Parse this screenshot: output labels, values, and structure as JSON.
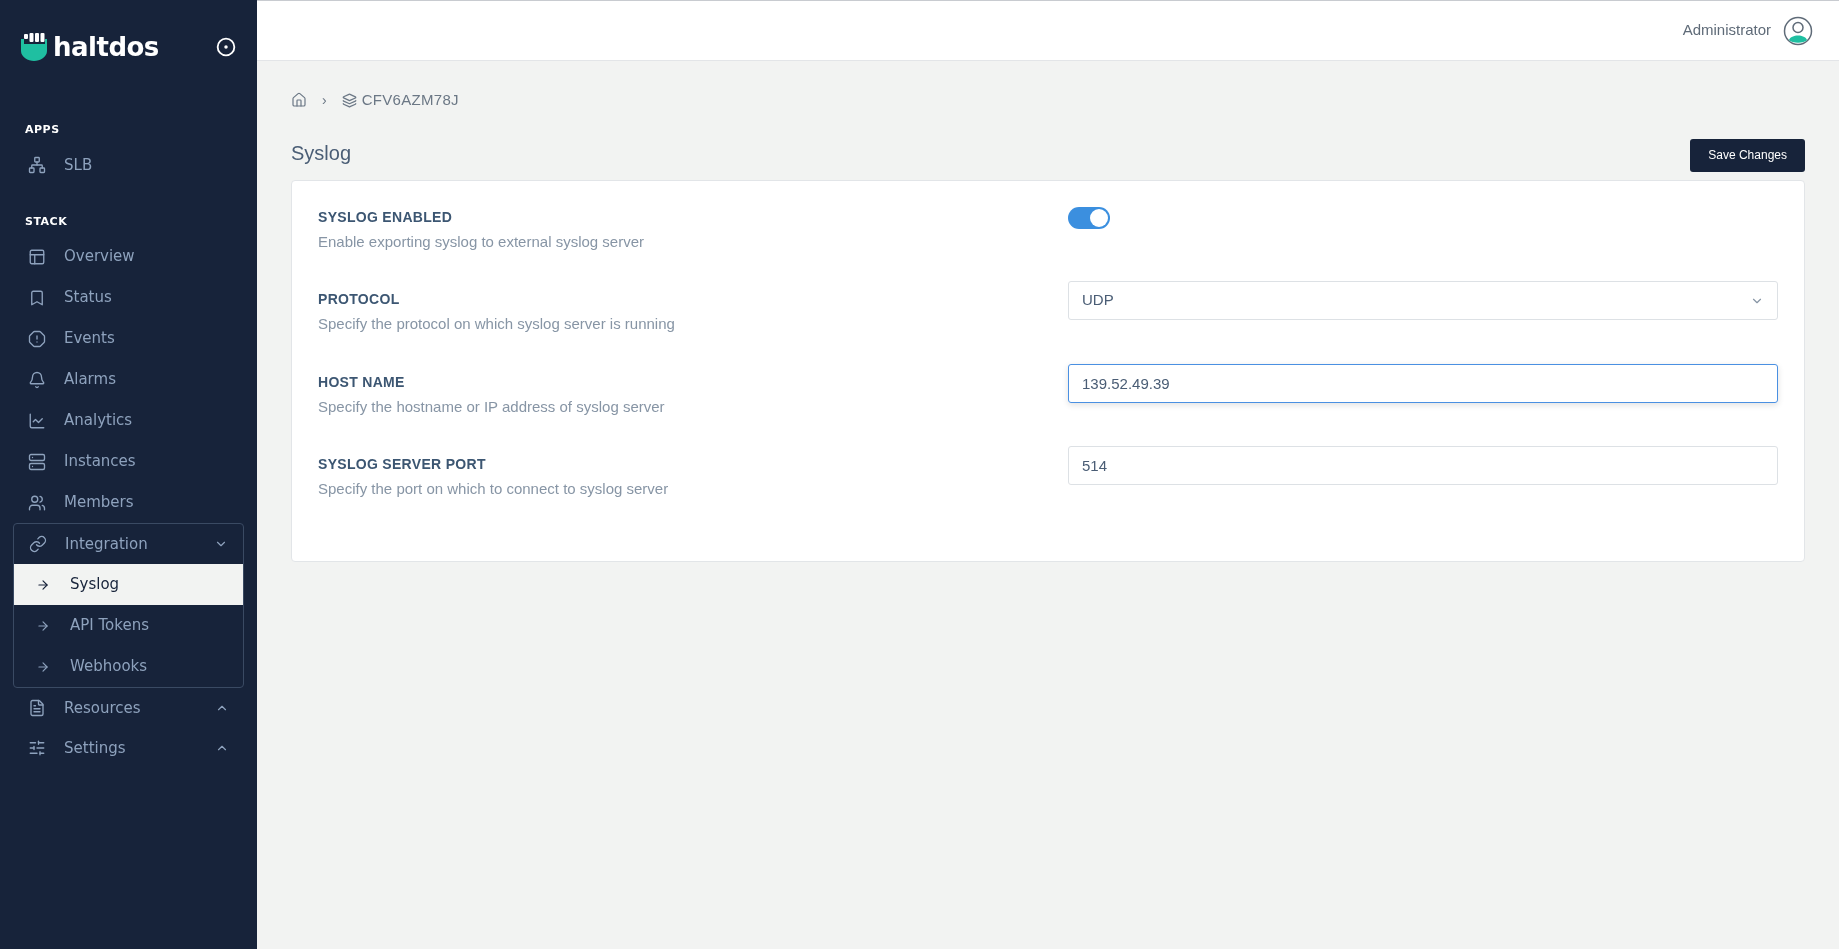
{
  "brand": {
    "name": "haltdos"
  },
  "sidebar": {
    "sections": [
      {
        "title": "APPS",
        "items": [
          {
            "kind": "item",
            "label": "SLB"
          }
        ]
      },
      {
        "title": "STACK",
        "items": [
          {
            "kind": "item",
            "label": "Overview"
          },
          {
            "kind": "item",
            "label": "Status"
          },
          {
            "kind": "item",
            "label": "Events"
          },
          {
            "kind": "item",
            "label": "Alarms"
          },
          {
            "kind": "item",
            "label": "Analytics"
          },
          {
            "kind": "item",
            "label": "Instances"
          },
          {
            "kind": "item",
            "label": "Members"
          },
          {
            "kind": "group",
            "label": "Integration",
            "expanded": true,
            "children": [
              {
                "label": "Syslog",
                "selected": true
              },
              {
                "label": "API Tokens",
                "selected": false
              },
              {
                "label": "Webhooks",
                "selected": false
              }
            ]
          },
          {
            "kind": "group",
            "label": "Resources",
            "expanded": false
          },
          {
            "kind": "group",
            "label": "Settings",
            "expanded": false
          }
        ]
      }
    ]
  },
  "header": {
    "user": "Administrator"
  },
  "breadcrumb": {
    "current": "CFV6AZM78J",
    "separator": "›"
  },
  "page": {
    "title": "Syslog",
    "save_button": "Save Changes"
  },
  "settings": [
    {
      "kind": "toggle",
      "label": "SYSLOG ENABLED",
      "description": "Enable exporting syslog to external syslog server",
      "on": true
    },
    {
      "kind": "select",
      "label": "PROTOCOL",
      "description": "Specify the protocol on which syslog server is running",
      "value": "UDP"
    },
    {
      "kind": "text",
      "label": "HOST NAME",
      "description": "Specify the hostname or IP address of syslog server",
      "value": "139.52.49.39",
      "focused": true
    },
    {
      "kind": "text",
      "label": "SYSLOG SERVER PORT",
      "description": "Specify the port on which to connect to syslog server",
      "value": "514",
      "focused": false
    }
  ]
}
